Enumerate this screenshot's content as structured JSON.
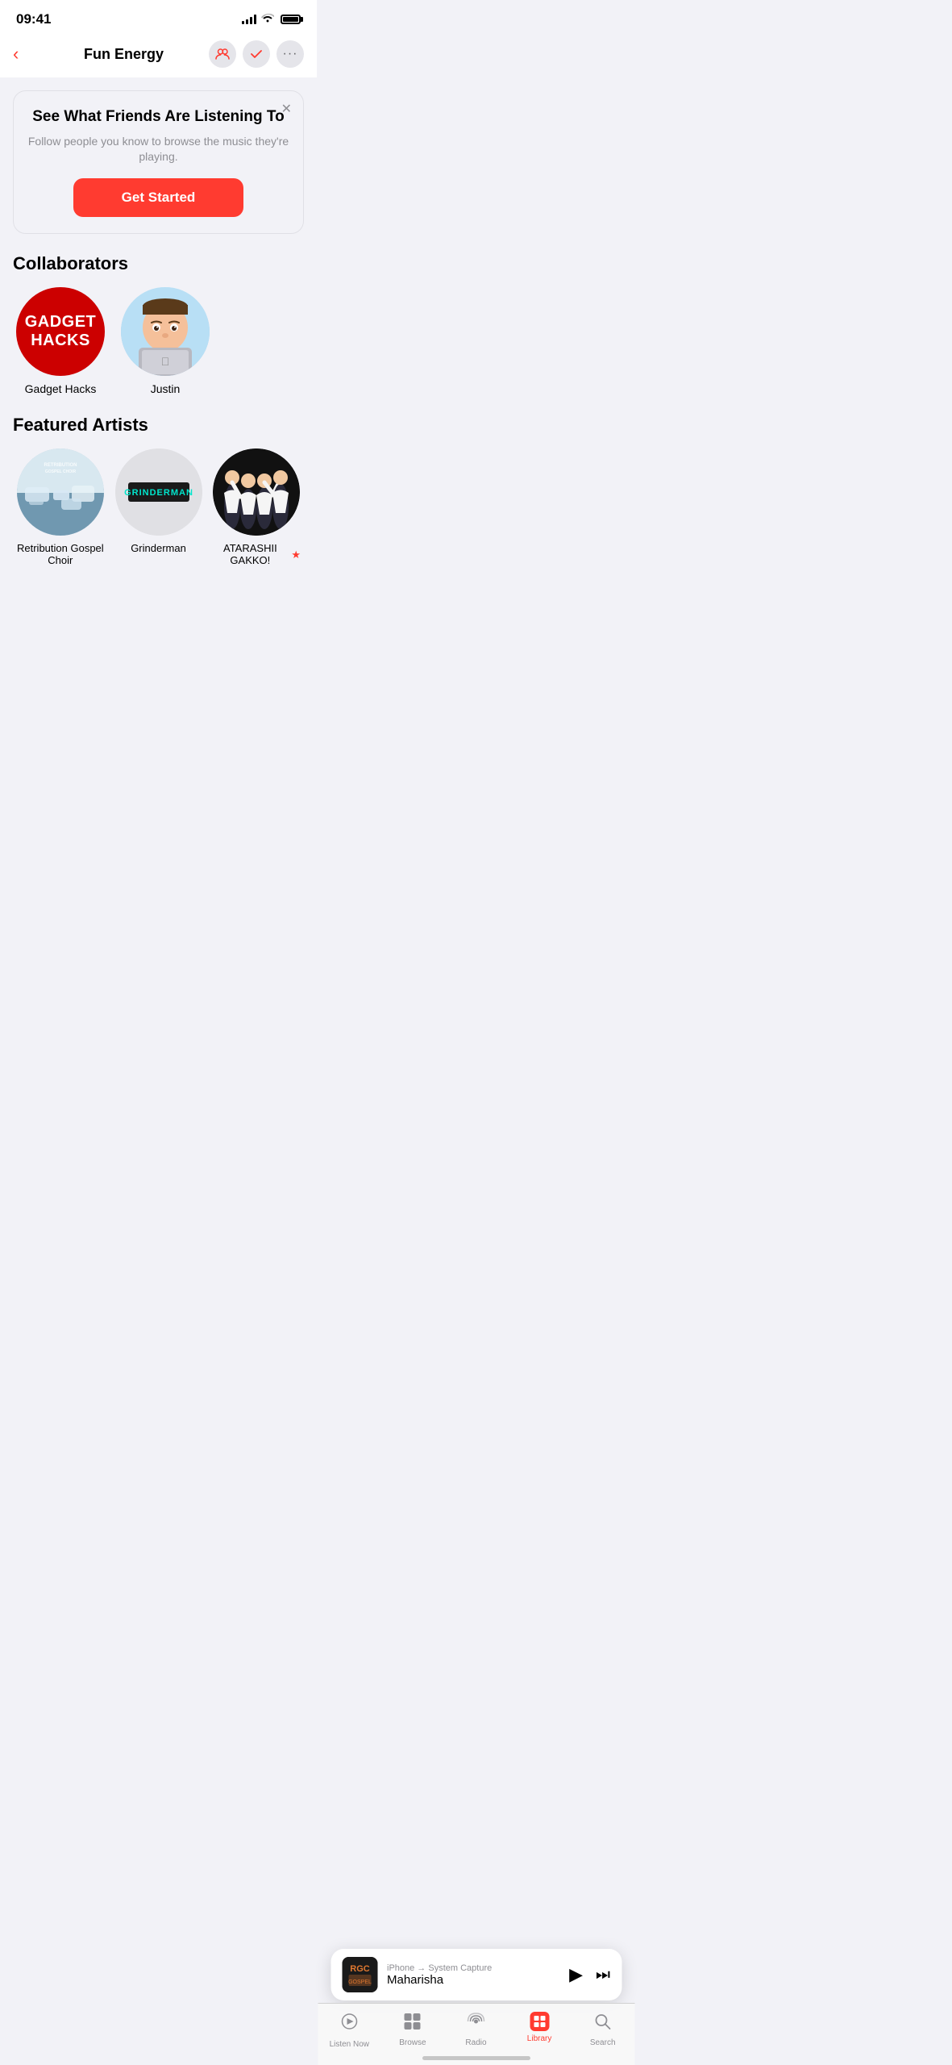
{
  "statusBar": {
    "time": "09:41"
  },
  "navBar": {
    "title": "Fun Energy",
    "backLabel": "‹"
  },
  "banner": {
    "title": "See What Friends Are Listening To",
    "subtitle": "Follow people you know to browse the music they're playing.",
    "cta": "Get Started"
  },
  "collaborators": {
    "sectionTitle": "Collaborators",
    "items": [
      {
        "name": "Gadget Hacks",
        "type": "gadget-hacks"
      },
      {
        "name": "Justin",
        "type": "justin"
      }
    ]
  },
  "featuredArtists": {
    "sectionTitle": "Featured Artists",
    "items": [
      {
        "name": "Retribution Gospel Choir",
        "type": "retribution",
        "starred": false
      },
      {
        "name": "Grinderman",
        "type": "grinderman",
        "starred": false
      },
      {
        "name": "ATARASHII GAKKO!",
        "type": "atarashii",
        "starred": true
      }
    ]
  },
  "nowPlaying": {
    "source": "iPhone → System Capture",
    "title": "Maharisha",
    "artText": "RGC"
  },
  "tabBar": {
    "items": [
      {
        "id": "listen-now",
        "label": "Listen Now",
        "active": false
      },
      {
        "id": "browse",
        "label": "Browse",
        "active": false
      },
      {
        "id": "radio",
        "label": "Radio",
        "active": false
      },
      {
        "id": "library",
        "label": "Library",
        "active": true
      },
      {
        "id": "search",
        "label": "Search",
        "active": false
      }
    ]
  }
}
